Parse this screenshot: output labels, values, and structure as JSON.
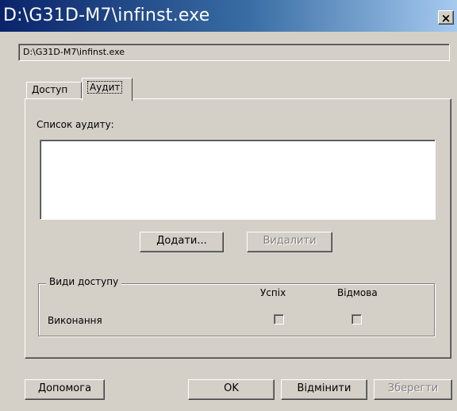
{
  "window": {
    "title": "D:\\G31D-M7\\infinst.exe",
    "close_label": "×"
  },
  "path": "D:\\G31D-M7\\infinst.exe",
  "tabs": [
    {
      "label": "Доступ",
      "selected": false
    },
    {
      "label": "Аудит",
      "selected": true
    }
  ],
  "audit": {
    "list_label": "Список аудиту:",
    "add_label": "Додати...",
    "remove_label": "Видалити"
  },
  "access_types": {
    "legend": "Види доступу",
    "col_success": "Успіх",
    "col_failure": "Відмова",
    "rows": [
      {
        "label": "Виконання",
        "success": false,
        "failure": false
      }
    ]
  },
  "footer": {
    "help_label": "Допомога",
    "ok_label": "OK",
    "cancel_label": "Відмінити",
    "save_label": "Зберегти"
  }
}
